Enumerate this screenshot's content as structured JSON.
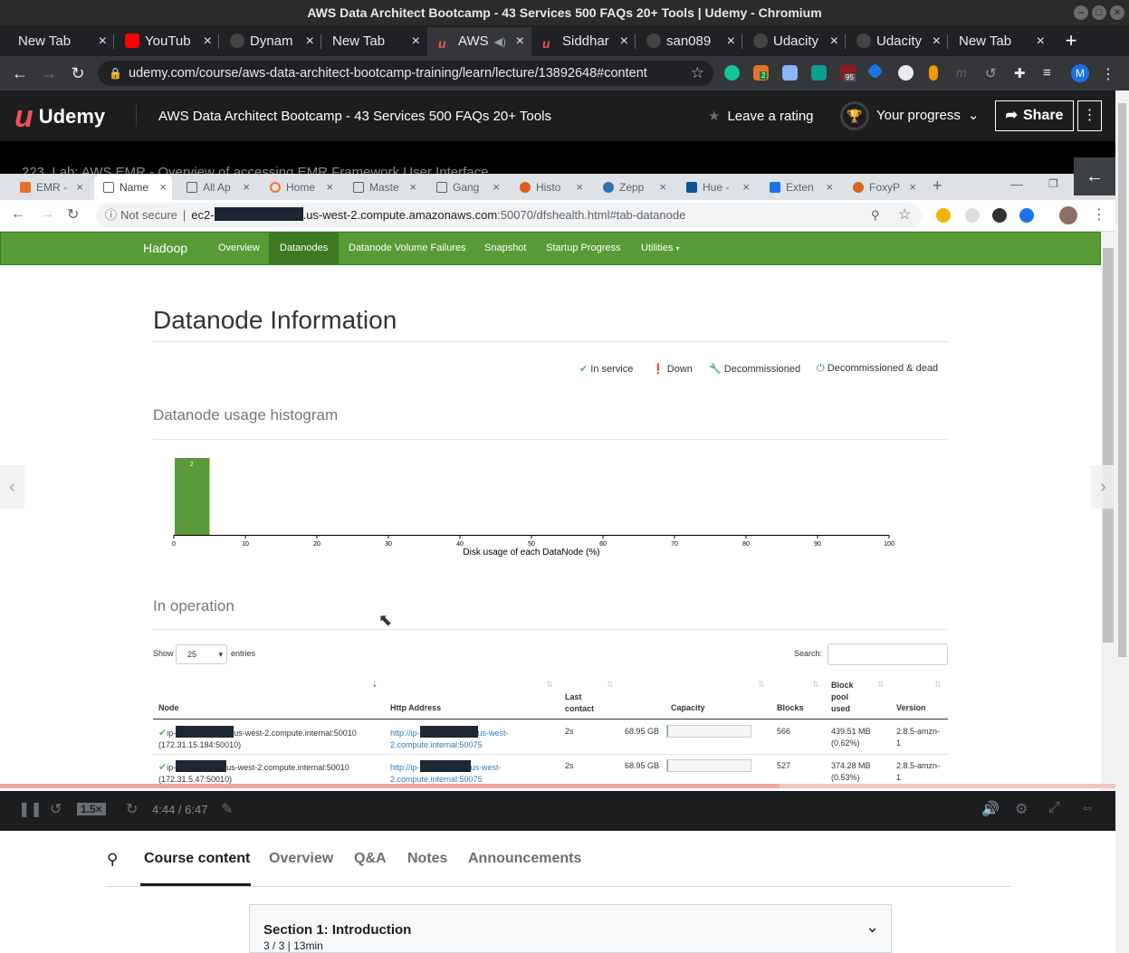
{
  "window": {
    "title": "AWS Data Architect Bootcamp - 43 Services 500 FAQs 20+ Tools | Udemy - Chromium"
  },
  "outer_tabs": [
    {
      "label": "New Tab",
      "icon": "none"
    },
    {
      "label": "YouTub",
      "icon": "youtube-icon"
    },
    {
      "label": "Dynam",
      "icon": "github-icon"
    },
    {
      "label": "New Tab",
      "icon": "none"
    },
    {
      "label": "AWS",
      "icon": "udemy-icon"
    },
    {
      "label": "Siddhar",
      "icon": "udemy-icon"
    },
    {
      "label": "san089",
      "icon": "github-icon"
    },
    {
      "label": "Udacity",
      "icon": "github-icon"
    },
    {
      "label": "Udacity",
      "icon": "github-icon"
    },
    {
      "label": "New Tab",
      "icon": "none"
    }
  ],
  "outer_url": "udemy.com/course/aws-data-architect-bootcamp-training/learn/lecture/13892648#content",
  "extension_badges": {
    "ext2": "2",
    "ext7": "95"
  },
  "profile_initial": "M",
  "udemy": {
    "logo": "Udemy",
    "course_title": "AWS Data Architect Bootcamp - 43 Services 500 FAQs 20+ Tools",
    "rate_label": "Leave a rating",
    "progress_label": "Your progress",
    "share_label": "Share",
    "lecture_title": "223. Lab: AWS EMR - Overview of accessing EMR Framework User Interface"
  },
  "inner_tabs": [
    "EMR -",
    "Name",
    "All Ap",
    "Home",
    "Maste",
    "Gang",
    "Histo",
    "Zepp",
    "Hue -",
    "Exten",
    "FoxyP"
  ],
  "inner_url": {
    "not_secure": "Not secure",
    "prefix": "ec2-",
    "host_suffix": ".us-west-2.compute.amazonaws.com",
    "path": ":50070/dfshealth.html#tab-datanode"
  },
  "hadoop_nav": {
    "brand": "Hadoop",
    "items": [
      "Overview",
      "Datanodes",
      "Datanode Volume Failures",
      "Snapshot",
      "Startup Progress",
      "Utilities"
    ]
  },
  "page": {
    "title": "Datanode Information",
    "legend": [
      "In service",
      "Down",
      "Decommissioned",
      "Decommissioned & dead"
    ],
    "histogram_title": "Datanode usage histogram",
    "in_operation_title": "In operation",
    "show_label": "Show",
    "entries_value": "25",
    "entries_label": "entries",
    "search_label": "Search:"
  },
  "chart_data": {
    "type": "bar",
    "x_edges": [
      0,
      5
    ],
    "values": [
      2
    ],
    "data_labels": [
      "2"
    ],
    "xlim": [
      0,
      100
    ],
    "xticks": [
      "0",
      "10",
      "20",
      "30",
      "40",
      "50",
      "60",
      "70",
      "80",
      "90",
      "100"
    ],
    "xlabel": "Disk usage of each DataNode (%)",
    "color": "#5a9a3a"
  },
  "table": {
    "headers": [
      "Node",
      "Http Address",
      "Last contact",
      "Capacity",
      "Blocks",
      "Block pool used",
      "Version"
    ],
    "rows": [
      {
        "node_prefix": "ip-",
        "node_suffix": "us-west-2.compute.internal:50010",
        "node_ip": "(172.31.15.184:50010)",
        "http_prefix": "http://ip-",
        "http_suffix": "us-west-",
        "http_line2": "2.compute.internal:50075",
        "last_contact": "2s",
        "capacity": "68.95 GB",
        "blocks": "566",
        "bp_used": "439.51 MB",
        "bp_pct": "(0.62%)",
        "version": "2.8.5-amzn-",
        "version2": "1"
      },
      {
        "node_prefix": "ip-",
        "node_suffix": "us-west-2.compute.internal:50010",
        "node_ip": "(172.31.5.47:50010)",
        "http_prefix": "http://ip-",
        "http_suffix": "us-west-",
        "http_line2": "2.compute.internal:50075",
        "last_contact": "2s",
        "capacity": "68.95 GB",
        "blocks": "527",
        "bp_used": "374.28 MB",
        "bp_pct": "(0.53%)",
        "version": "2.8.5-amzn-",
        "version2": "1"
      }
    ]
  },
  "player": {
    "speed": "1.5×",
    "time": "4:44 / 6:47",
    "played_fraction": 0.699
  },
  "course_tabs": [
    "Course content",
    "Overview",
    "Q&A",
    "Notes",
    "Announcements"
  ],
  "section": {
    "title": "Section 1: Introduction",
    "meta": "3 / 3 | 13min"
  }
}
